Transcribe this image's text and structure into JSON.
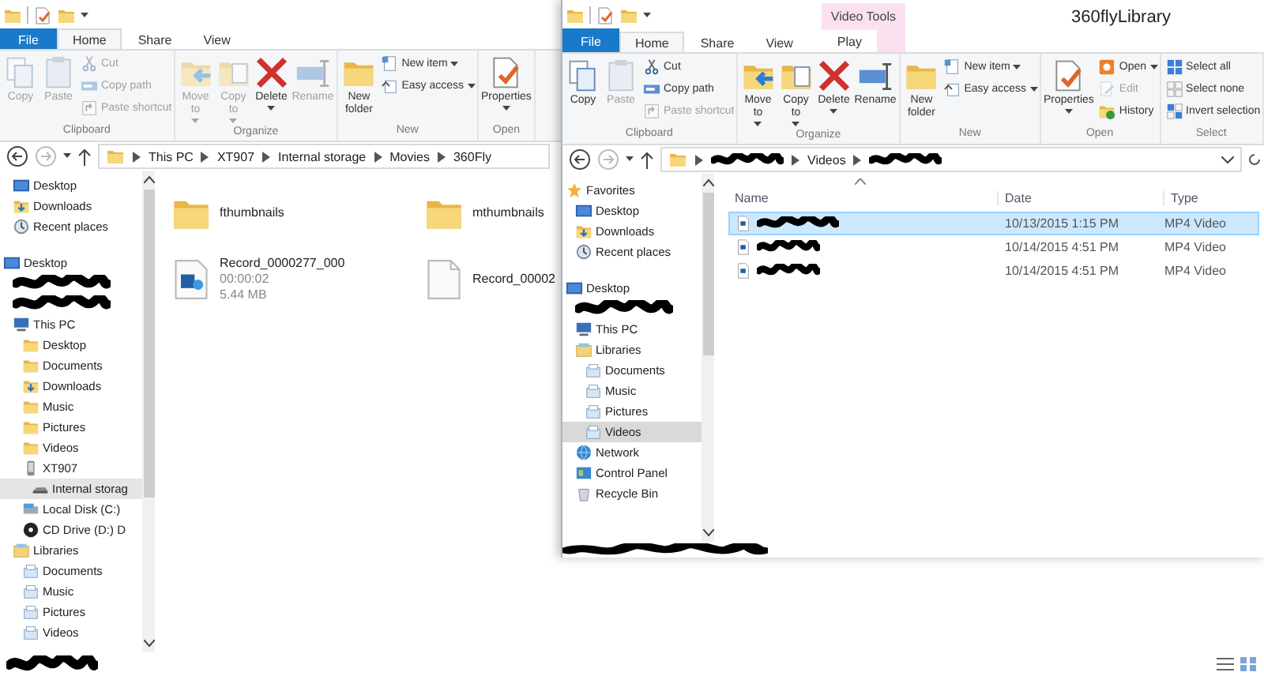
{
  "back_window": {
    "tabs": [
      {
        "label": "File",
        "kind": "file",
        "selected": false
      },
      {
        "label": "Home",
        "kind": "tab",
        "selected": true
      },
      {
        "label": "Share",
        "kind": "tab",
        "selected": false
      },
      {
        "label": "View",
        "kind": "tab",
        "selected": false
      }
    ],
    "ribbon": [
      {
        "label": "Clipboard",
        "buttons": [
          {
            "label": "Copy",
            "kind": "copy",
            "disabled": true
          },
          {
            "label": "Paste",
            "kind": "paste",
            "disabled": true
          }
        ],
        "commands": [
          {
            "label": "Cut",
            "kind": "cut",
            "disabled": true
          },
          {
            "label": "Copy path",
            "kind": "path",
            "disabled": true
          },
          {
            "label": "Paste shortcut",
            "kind": "shortcut",
            "disabled": true
          }
        ]
      },
      {
        "label": "Organize",
        "buttons": [
          {
            "label": "Move to",
            "kind": "moveto",
            "disabled": true,
            "dropdown": true
          },
          {
            "label": "Copy to",
            "kind": "copyto",
            "disabled": true,
            "dropdown": true
          },
          {
            "label": "Delete",
            "kind": "delete",
            "disabled": false,
            "dropdown": true
          },
          {
            "label": "Rename",
            "kind": "rename",
            "disabled": true
          }
        ]
      },
      {
        "label": "New",
        "buttons": [
          {
            "label": "New folder",
            "kind": "folder",
            "disabled": false
          }
        ],
        "commands": [
          {
            "label": "New item",
            "kind": "newitem",
            "disabled": false,
            "dropdown": true
          },
          {
            "label": "Easy access",
            "kind": "easy",
            "disabled": false,
            "dropdown": true
          }
        ]
      },
      {
        "label": "Open",
        "buttons": [
          {
            "label": "Properties",
            "kind": "properties",
            "disabled": false,
            "dropdown": true
          }
        ]
      }
    ],
    "address": [
      {
        "label": "This PC"
      },
      {
        "label": "XT907"
      },
      {
        "label": "Internal storage"
      },
      {
        "label": "Movies"
      },
      {
        "label": "360Fly"
      }
    ],
    "nav": [
      {
        "children": [
          {
            "label": "Desktop",
            "kind": "desktop",
            "selected": false
          },
          {
            "label": "Downloads",
            "kind": "downloads",
            "selected": false
          },
          {
            "label": "Recent places",
            "kind": "recent",
            "selected": false
          }
        ]
      },
      {
        "label": "Desktop",
        "kind": "desktop",
        "selected": false,
        "children": [
          {
            "kind": "redacted"
          },
          {
            "kind": "redacted"
          },
          {
            "label": "This PC",
            "kind": "pc",
            "selected": false,
            "children": [
              {
                "label": "Desktop",
                "kind": "folder",
                "selected": false
              },
              {
                "label": "Documents",
                "kind": "folder",
                "selected": false
              },
              {
                "label": "Downloads",
                "kind": "downloads",
                "selected": false
              },
              {
                "label": "Music",
                "kind": "folder",
                "selected": false
              },
              {
                "label": "Pictures",
                "kind": "folder",
                "selected": false
              },
              {
                "label": "Videos",
                "kind": "folder",
                "selected": false
              },
              {
                "label": "XT907",
                "kind": "phone",
                "selected": false,
                "children": [
                  {
                    "label": "Internal storag",
                    "kind": "drive",
                    "selected": true
                  }
                ]
              },
              {
                "label": "Local Disk (C:)",
                "kind": "disk",
                "selected": false
              },
              {
                "label": "CD Drive (D:) D",
                "kind": "cd",
                "selected": false
              }
            ]
          },
          {
            "label": "Libraries",
            "kind": "library",
            "selected": false,
            "children": [
              {
                "label": "Documents",
                "kind": "libitem",
                "selected": false
              },
              {
                "label": "Music",
                "kind": "libitem",
                "selected": false
              },
              {
                "label": "Pictures",
                "kind": "libitem",
                "selected": false
              },
              {
                "label": "Videos",
                "kind": "libitem",
                "selected": false
              }
            ]
          }
        ]
      }
    ],
    "items": [
      {
        "name": "fthumbnails",
        "kind": "folder"
      },
      {
        "name": "mthumbnails",
        "kind": "folder"
      },
      {
        "name": "Record_0000277_000",
        "kind": "video",
        "details": [
          "00:00:02",
          "5.44 MB"
        ]
      },
      {
        "name": "Record_00002",
        "kind": "file"
      }
    ]
  },
  "front_window": {
    "title": "360flyLibrary",
    "context": "Video Tools",
    "tabs": [
      {
        "label": "File",
        "kind": "file",
        "selected": false
      },
      {
        "label": "Home",
        "kind": "tab",
        "selected": true
      },
      {
        "label": "Share",
        "kind": "tab",
        "selected": false
      },
      {
        "label": "View",
        "kind": "tab",
        "selected": false
      },
      {
        "label": "Play",
        "kind": "contextual",
        "selected": false
      }
    ],
    "ribbon": [
      {
        "label": "Clipboard",
        "buttons": [
          {
            "label": "Copy",
            "kind": "copy",
            "disabled": false
          },
          {
            "label": "Paste",
            "kind": "paste",
            "disabled": true
          }
        ],
        "commands": [
          {
            "label": "Cut",
            "kind": "cut",
            "disabled": false
          },
          {
            "label": "Copy path",
            "kind": "path",
            "disabled": false
          },
          {
            "label": "Paste shortcut",
            "kind": "shortcut",
            "disabled": true
          }
        ]
      },
      {
        "label": "Organize",
        "buttons": [
          {
            "label": "Move to",
            "kind": "moveto",
            "disabled": false,
            "dropdown": true
          },
          {
            "label": "Copy to",
            "kind": "copyto",
            "disabled": false,
            "dropdown": true
          },
          {
            "label": "Delete",
            "kind": "delete",
            "disabled": false,
            "dropdown": true
          },
          {
            "label": "Rename",
            "kind": "rename",
            "disabled": false
          }
        ]
      },
      {
        "label": "New",
        "buttons": [
          {
            "label": "New folder",
            "kind": "folder",
            "disabled": false
          }
        ],
        "commands": [
          {
            "label": "New item",
            "kind": "newitem",
            "disabled": false,
            "dropdown": true
          },
          {
            "label": "Easy access",
            "kind": "easy",
            "disabled": false,
            "dropdown": true
          }
        ]
      },
      {
        "label": "Open",
        "buttons": [
          {
            "label": "Properties",
            "kind": "properties",
            "disabled": false,
            "dropdown": true
          }
        ],
        "commands": [
          {
            "label": "Open",
            "kind": "open",
            "disabled": false,
            "dropdown": true
          },
          {
            "label": "Edit",
            "kind": "edit",
            "disabled": true
          },
          {
            "label": "History",
            "kind": "history",
            "disabled": false
          }
        ]
      },
      {
        "label": "Select",
        "commands": [
          {
            "label": "Select all",
            "kind": "selectall",
            "disabled": false
          },
          {
            "label": "Select none",
            "kind": "selectnone",
            "disabled": false
          },
          {
            "label": "Invert selection",
            "kind": "invert",
            "disabled": false
          }
        ]
      }
    ],
    "address": [
      {
        "kind": "redacted"
      },
      {
        "label": "Videos"
      },
      {
        "kind": "redacted"
      }
    ],
    "nav": [
      {
        "label": "Favorites",
        "kind": "star",
        "selected": false,
        "children": [
          {
            "label": "Desktop",
            "kind": "desktop",
            "selected": false
          },
          {
            "label": "Downloads",
            "kind": "downloads",
            "selected": false
          },
          {
            "label": "Recent places",
            "kind": "recent",
            "selected": false
          }
        ]
      },
      {
        "label": "Desktop",
        "kind": "desktop",
        "selected": false,
        "children": [
          {
            "kind": "redacted"
          },
          {
            "label": "This PC",
            "kind": "pc",
            "selected": false
          },
          {
            "label": "Libraries",
            "kind": "library",
            "selected": false,
            "children": [
              {
                "label": "Documents",
                "kind": "libitem",
                "selected": false
              },
              {
                "label": "Music",
                "kind": "libitem",
                "selected": false
              },
              {
                "label": "Pictures",
                "kind": "libitem",
                "selected": false
              },
              {
                "label": "Videos",
                "kind": "libitem",
                "selected": true
              }
            ]
          },
          {
            "label": "Network",
            "kind": "network",
            "selected": false
          },
          {
            "label": "Control Panel",
            "kind": "control",
            "selected": false
          },
          {
            "label": "Recycle Bin",
            "kind": "bin",
            "selected": false
          }
        ]
      }
    ],
    "columns": [
      "Name",
      "Date",
      "Type"
    ],
    "rows": [
      {
        "date": "10/13/2015 1:15 PM",
        "type": "MP4 Video",
        "selected": true
      },
      {
        "date": "10/14/2015 4:51 PM",
        "type": "MP4 Video",
        "selected": false
      },
      {
        "date": "10/14/2015 4:51 PM",
        "type": "MP4 Video",
        "selected": false
      }
    ]
  }
}
